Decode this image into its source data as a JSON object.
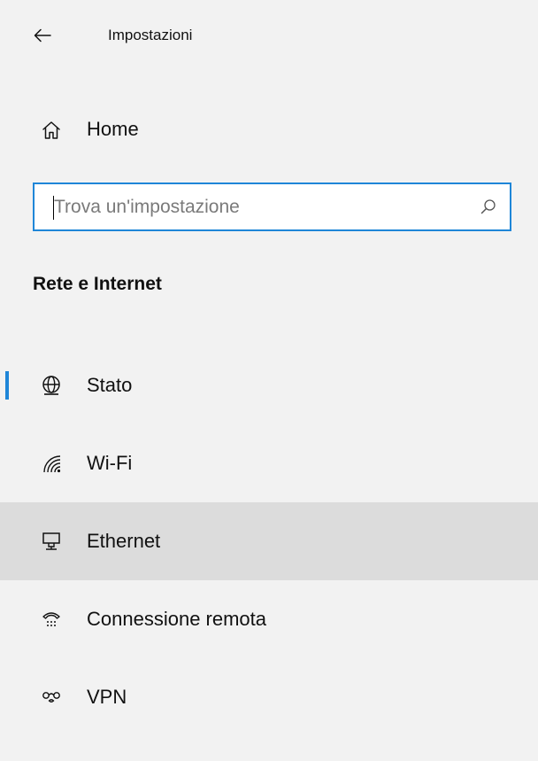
{
  "window": {
    "title": "Impostazioni",
    "back_icon": "arrow-left-icon"
  },
  "home": {
    "label": "Home",
    "icon": "home-icon"
  },
  "search": {
    "placeholder": "Trova un'impostazione",
    "value": "",
    "icon": "search-icon"
  },
  "section": {
    "title": "Rete e Internet"
  },
  "nav": {
    "items": [
      {
        "label": "Stato",
        "icon": "globe-status-icon",
        "selected": true
      },
      {
        "label": "Wi-Fi",
        "icon": "wifi-icon",
        "selected": false
      },
      {
        "label": "Ethernet",
        "icon": "ethernet-icon",
        "selected": false,
        "hovered": true
      },
      {
        "label": "Connessione remota",
        "icon": "dialup-phone-icon",
        "selected": false
      },
      {
        "label": "VPN",
        "icon": "vpn-icon",
        "selected": false
      }
    ]
  },
  "colors": {
    "accent": "#1f86d8",
    "background": "#f2f2f2",
    "hover": "#dcdcdc",
    "text": "#111111"
  }
}
